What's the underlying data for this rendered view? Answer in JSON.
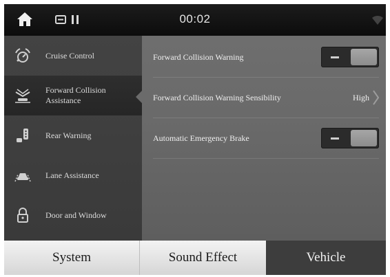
{
  "status_bar": {
    "clock": "00:02",
    "home_icon": "home-icon",
    "media_icon": "media-pause-icon",
    "signal_icon": "wifi-icon"
  },
  "sidebar": {
    "items": [
      {
        "label": "Cruise Control",
        "icon": "cruise-control-icon",
        "active": false
      },
      {
        "label": "Forward Collision Assistance",
        "icon": "forward-collision-icon",
        "active": true
      },
      {
        "label": "Rear Warning",
        "icon": "rear-warning-icon",
        "active": false
      },
      {
        "label": "Lane Assistance",
        "icon": "lane-assistance-icon",
        "active": false
      },
      {
        "label": "Door and Window",
        "icon": "door-lock-icon",
        "active": false
      }
    ]
  },
  "settings": [
    {
      "label": "Forward Collision Warning",
      "type": "toggle"
    },
    {
      "label": "Forward Collision Warning Sensibility",
      "type": "value",
      "value": "High"
    },
    {
      "label": "Automatic Emergency Brake",
      "type": "toggle"
    }
  ],
  "tabs": [
    {
      "label": "System",
      "selected": false
    },
    {
      "label": "Sound Effect",
      "selected": false
    },
    {
      "label": "Vehicle",
      "selected": true
    }
  ],
  "colors": {
    "status_bar": "#141414",
    "sidebar": "#3f3f3f",
    "sidebar_active": "#2a2a2a",
    "content": "#6a6a6a",
    "tab_light": "#e6e6e6",
    "tab_selected": "#3d3d3d"
  }
}
